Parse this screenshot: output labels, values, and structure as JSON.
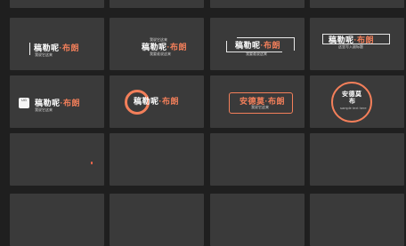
{
  "captions": {
    "brand_prefix": "稿勒呢",
    "brand_dot": "·",
    "brand_suffix": "布朗",
    "sub_a": "我说它这来",
    "sub_b": "我说它这来",
    "sub_c": "我要谁说这来",
    "sub_d": "这里写入副标题",
    "sub_e": "我要谁说这来",
    "alt_title": "安德莫·布朗",
    "alt_title_2": "安德莫·布朗",
    "ring_title_l1": "安德莫",
    "ring_title_l2": "布",
    "ring_sub": "sample text here",
    "logo_text": "UG"
  },
  "colors": {
    "accent": "#f37f5a",
    "tile": "#3a3a3a",
    "background": "#1f1f1f"
  }
}
